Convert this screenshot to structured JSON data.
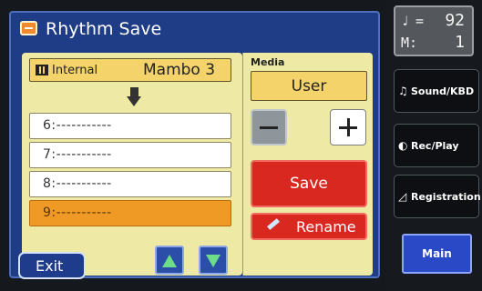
{
  "dialog": {
    "title": "Rhythm Save",
    "source": {
      "label": "Internal",
      "name": "Mambo 3"
    },
    "slots": [
      {
        "label": "6:-----------",
        "selected": false
      },
      {
        "label": "7:-----------",
        "selected": false
      },
      {
        "label": "8:-----------",
        "selected": false
      },
      {
        "label": "9:-----------",
        "selected": true
      }
    ],
    "exit_label": "Exit",
    "media": {
      "label": "Media",
      "value": "User"
    },
    "save_label": "Save",
    "rename_label": "Rename"
  },
  "sidebar": {
    "tempo_value": "92",
    "measure_label": "M:",
    "measure_value": "1",
    "buttons": {
      "sound": "Sound/KBD",
      "rec": "Rec/Play",
      "registration": "Registration",
      "main": "Main"
    }
  },
  "colors": {
    "dialog_blue": "#1f3d86",
    "panel_cream": "#eeeaa6",
    "field_yellow": "#f4d36b",
    "selected_orange": "#f09a26",
    "action_red": "#d9281f",
    "arrow_green": "#6edd8a"
  },
  "icons": [
    "rhythm-save-icon",
    "internal-icon",
    "arrow-down-icon",
    "minus-icon",
    "plus-icon",
    "pencil-icon",
    "note-icon",
    "sound-icon",
    "rec-play-icon",
    "registration-icon"
  ]
}
